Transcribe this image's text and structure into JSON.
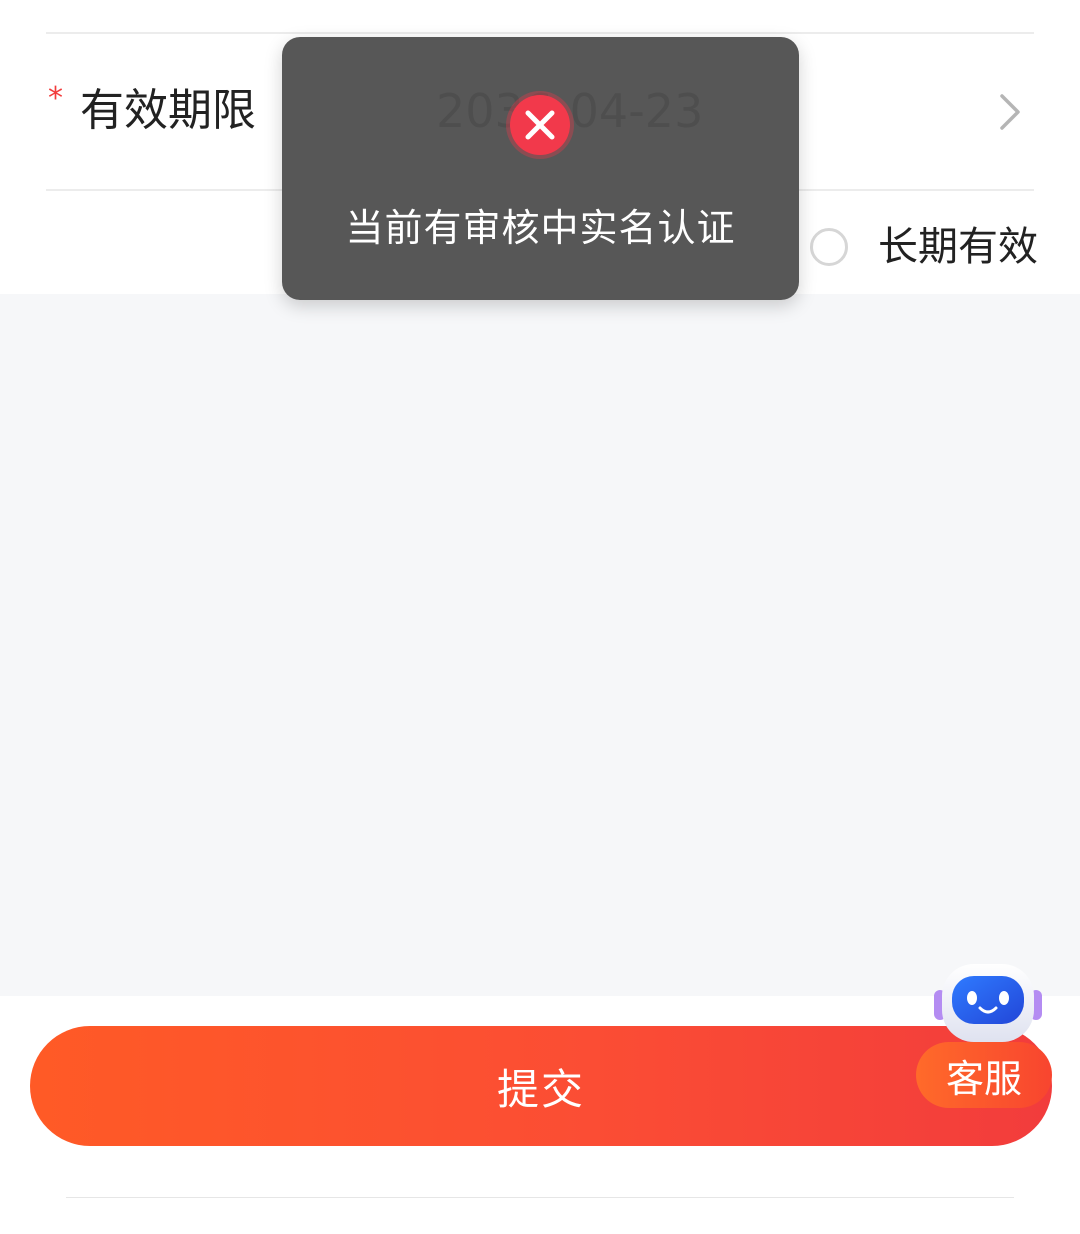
{
  "form": {
    "required_mark": "*",
    "expiry_label": "有效期限",
    "expiry_value": "2036-04-23",
    "long_term_label": "长期有效"
  },
  "submit": {
    "label": "提交",
    "colors": [
      "#ff5a26",
      "#f23c3c"
    ]
  },
  "customer_service": {
    "label": "客服",
    "icon": "robot-icon"
  },
  "toast": {
    "message": "当前有审核中实名认证",
    "icon": "error-close-icon",
    "icon_color": "#f2394b"
  },
  "colors": {
    "accent": "#fb4d34",
    "required": "#f23c3c",
    "page_gray": "#f6f7f9"
  }
}
